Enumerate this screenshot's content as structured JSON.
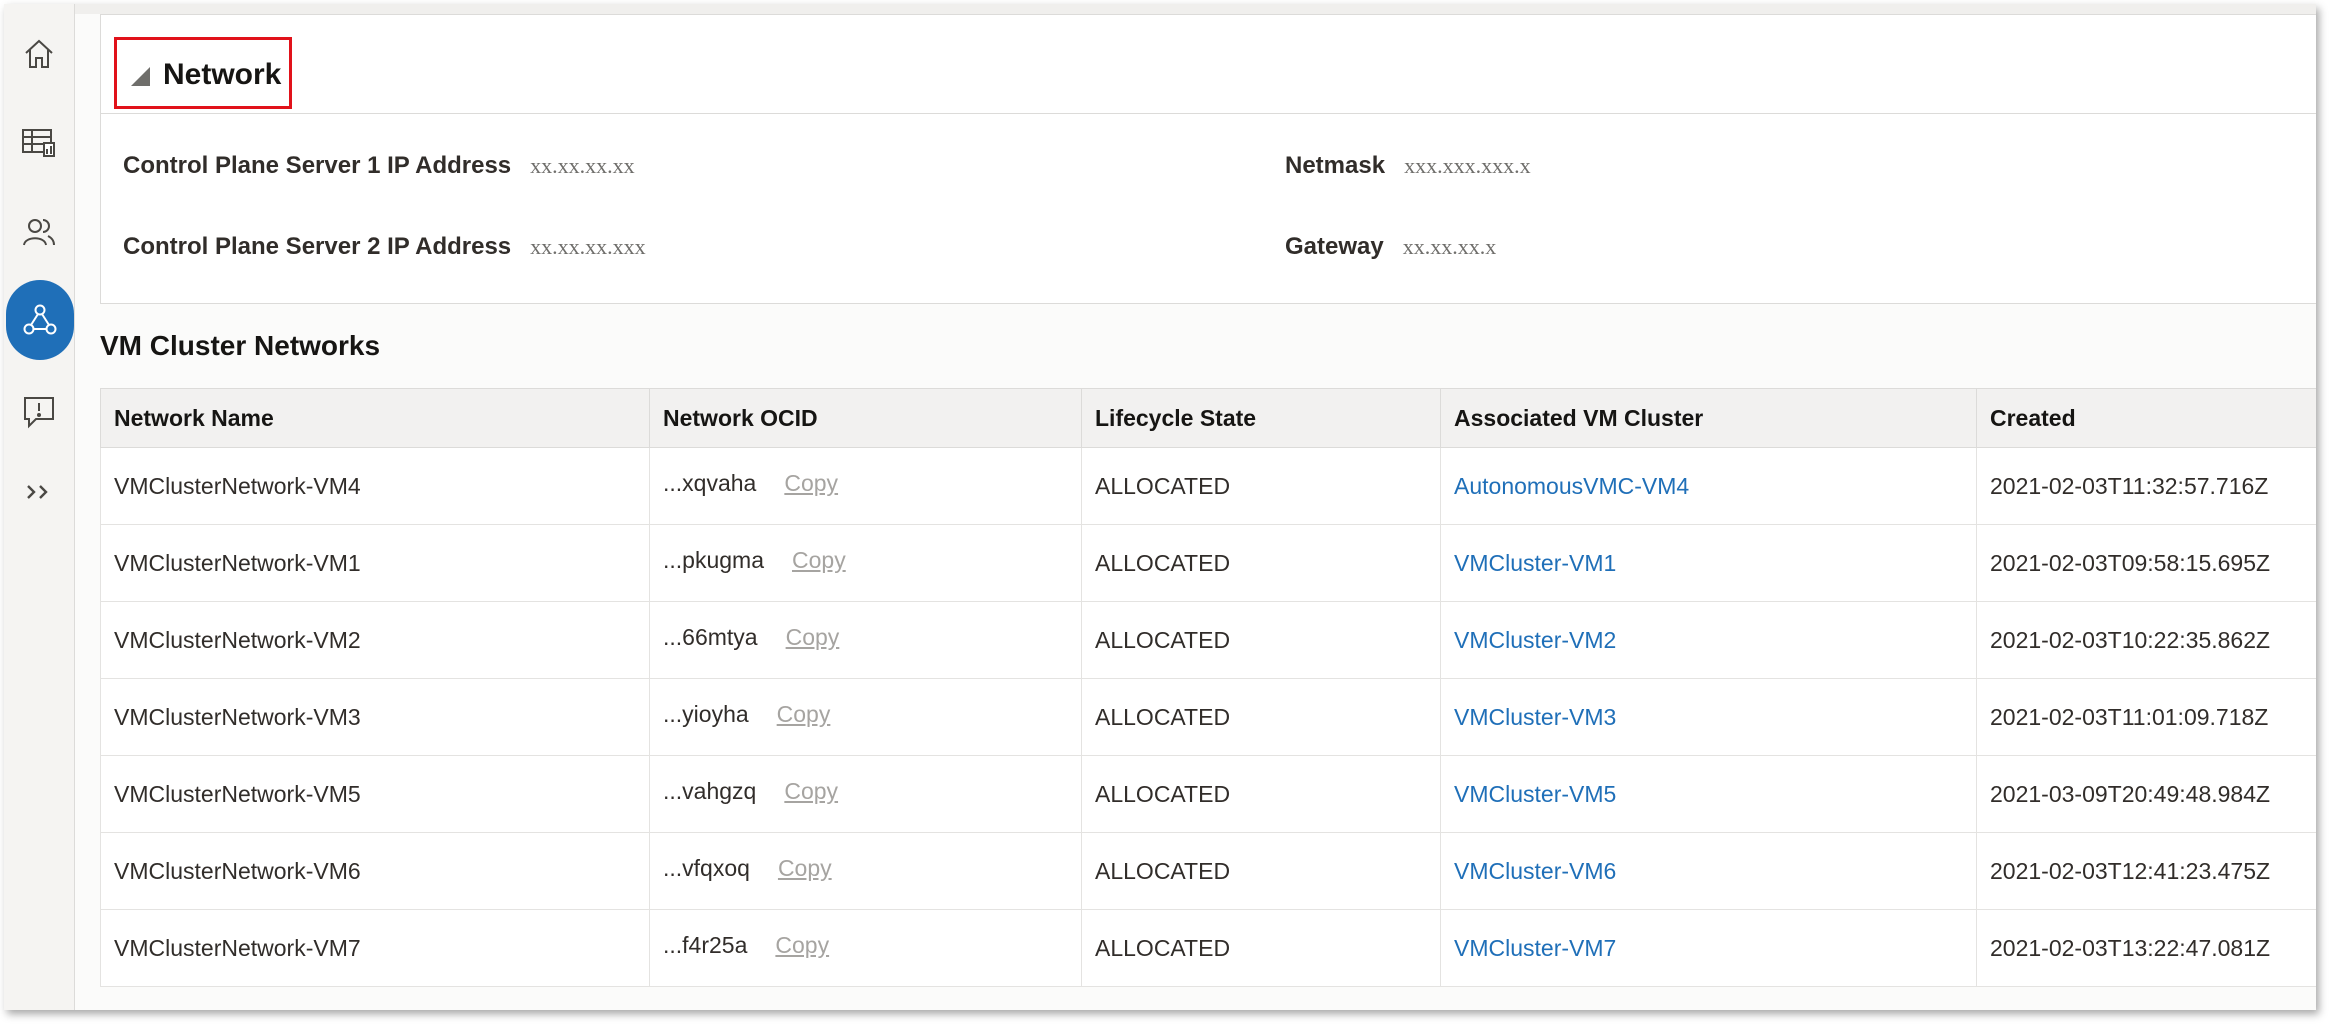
{
  "rail": {
    "items": [
      {
        "icon": "home-icon"
      },
      {
        "icon": "table-chart-icon"
      },
      {
        "icon": "users-icon"
      },
      {
        "icon": "network-icon",
        "active": true
      },
      {
        "icon": "alert-message-icon"
      },
      {
        "icon": "expand-chevrons-icon"
      }
    ],
    "active_color": "#1f6fb8"
  },
  "network": {
    "title": "Network",
    "cp1_label": "Control Plane Server 1 IP Address",
    "cp1_value": "xx.xx.xx.xx",
    "cp2_label": "Control Plane Server 2 IP Address",
    "cp2_value": "xx.xx.xx.xxx",
    "netmask_label": "Netmask",
    "netmask_value": "xxx.xxx.xxx.x",
    "gateway_label": "Gateway",
    "gateway_value": "xx.xx.xx.x",
    "highlight_color": "#e1121a"
  },
  "vmcn": {
    "title": "VM Cluster Networks",
    "columns": [
      "Network Name",
      "Network OCID",
      "Lifecycle State",
      "Associated VM Cluster",
      "Created"
    ],
    "copy_label": "Copy",
    "link_color": "#1f6fb8",
    "rows": [
      {
        "name": "VMClusterNetwork-VM4",
        "ocid": "...xqvaha",
        "state": "ALLOCATED",
        "cluster": "AutonomousVMC-VM4",
        "created": "2021-02-03T11:32:57.716Z"
      },
      {
        "name": "VMClusterNetwork-VM1",
        "ocid": "...pkugma",
        "state": "ALLOCATED",
        "cluster": "VMCluster-VM1",
        "created": "2021-02-03T09:58:15.695Z"
      },
      {
        "name": "VMClusterNetwork-VM2",
        "ocid": "...66mtya",
        "state": "ALLOCATED",
        "cluster": "VMCluster-VM2",
        "created": "2021-02-03T10:22:35.862Z"
      },
      {
        "name": "VMClusterNetwork-VM3",
        "ocid": "...yioyha",
        "state": "ALLOCATED",
        "cluster": "VMCluster-VM3",
        "created": "2021-02-03T11:01:09.718Z"
      },
      {
        "name": "VMClusterNetwork-VM5",
        "ocid": "...vahgzq",
        "state": "ALLOCATED",
        "cluster": "VMCluster-VM5",
        "created": "2021-03-09T20:49:48.984Z"
      },
      {
        "name": "VMClusterNetwork-VM6",
        "ocid": "...vfqxoq",
        "state": "ALLOCATED",
        "cluster": "VMCluster-VM6",
        "created": "2021-02-03T12:41:23.475Z"
      },
      {
        "name": "VMClusterNetwork-VM7",
        "ocid": "...f4r25a",
        "state": "ALLOCATED",
        "cluster": "VMCluster-VM7",
        "created": "2021-02-03T13:22:47.081Z"
      }
    ]
  }
}
